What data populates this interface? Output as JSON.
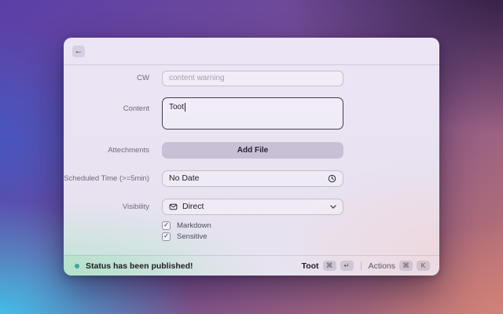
{
  "window": {
    "back_icon": "←",
    "form": {
      "cw": {
        "label": "CW",
        "placeholder": "content warning"
      },
      "content": {
        "label": "Content",
        "value": "Toot"
      },
      "attachments": {
        "label": "Attechments",
        "button": "Add File"
      },
      "scheduled": {
        "label": "Scheduled Time (>=5min)",
        "value": "No Date"
      },
      "visibility": {
        "label": "Visibility",
        "value": "Direct"
      },
      "markdown": {
        "label": "Markdown",
        "checked": true
      },
      "sensitive": {
        "label": "Sensitive",
        "checked": true
      }
    },
    "footer": {
      "status": "Status has been published!",
      "toot": {
        "label": "Toot",
        "keys": [
          "⌘",
          "↵"
        ]
      },
      "actions": {
        "label": "Actions",
        "keys": [
          "⌘",
          "K"
        ]
      }
    }
  },
  "icons": {
    "back": "←",
    "check": "✓",
    "clock": "clock-outline",
    "envelope": "envelope-outline",
    "chevron_down": "chevron-down"
  },
  "colors": {
    "status_dot": "#38a89d",
    "accent_text": "#1f1b26",
    "label_gray": "#6e6879"
  }
}
